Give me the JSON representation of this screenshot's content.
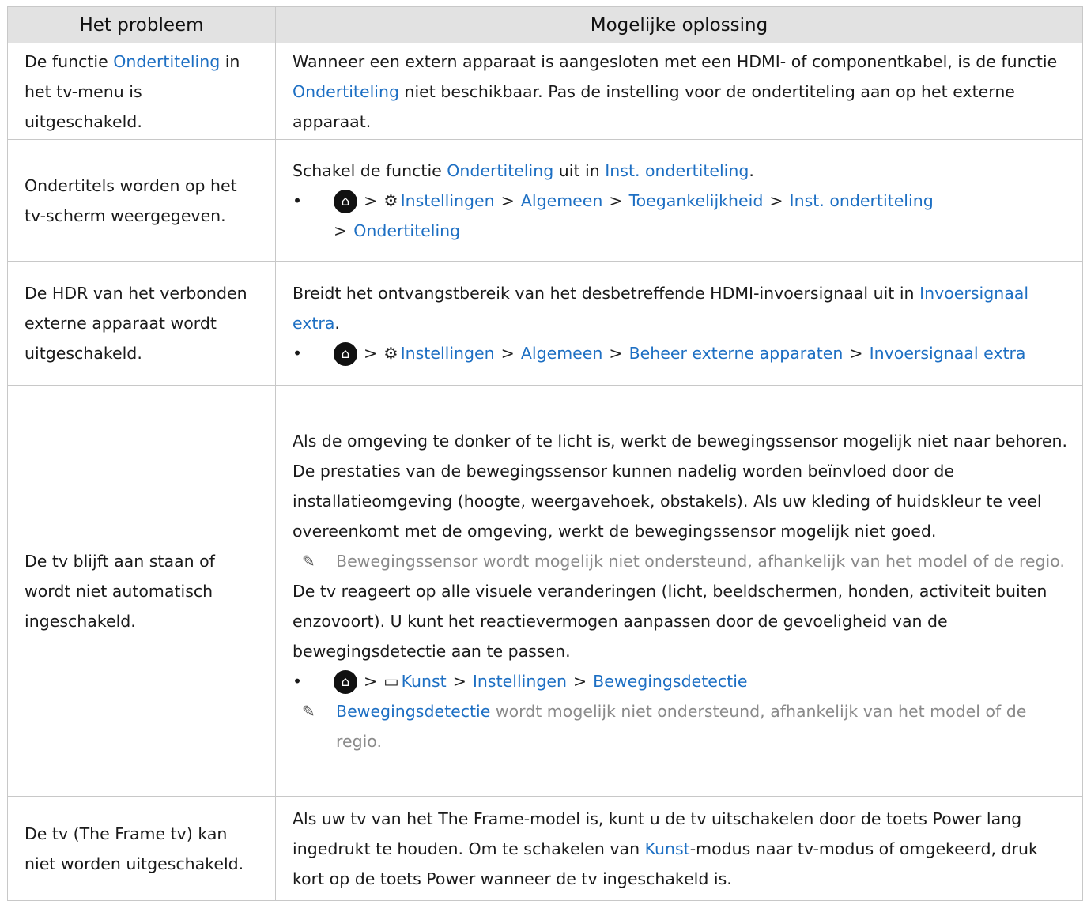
{
  "header": {
    "col1": "Het probleem",
    "col2": "Mogelijke oplossing"
  },
  "icons": {
    "home": "home-icon",
    "chevron": "chevron-right-icon",
    "gear": "gear-icon",
    "art": "art-mode-icon",
    "note": "pencil-note-icon",
    "bullet": "bullet"
  },
  "colors": {
    "link": "#1d6fc3",
    "note_text": "#8a8a8a",
    "header_bg": "#e2e2e2",
    "border": "#c8c8c8"
  },
  "rows": [
    {
      "problem": [
        "De functie ",
        "Ondertiteling",
        " in het tv-menu is uitgeschakeld."
      ],
      "solution": {
        "t1": "Wanneer een extern apparaat is aangesloten met een HDMI- of componentkabel, is de functie ",
        "l1": "Ondertiteling",
        "t2": " niet beschikbaar. Pas de instelling voor de ondertiteling aan op het externe apparaat."
      }
    },
    {
      "problem": "Ondertitels worden op het tv-scherm weergegeven.",
      "solution": {
        "t1": "Schakel de functie ",
        "l1": "Ondertiteling",
        "t2": " uit in ",
        "l2": "Inst. ondertiteling",
        "t3": ".",
        "path": [
          "Instellingen",
          "Algemeen",
          "Toegankelijkheid",
          "Inst. ondertiteling",
          "Ondertiteling"
        ]
      }
    },
    {
      "problem": "De HDR van het verbonden externe apparaat wordt uitgeschakeld.",
      "solution": {
        "t1": "Breidt het ontvangstbereik van het desbetreffende HDMI-invoersignaal uit in ",
        "l1": "Invoersignaal extra",
        "t2": ".",
        "path": [
          "Instellingen",
          "Algemeen",
          "Beheer externe apparaten",
          "Invoersignaal extra"
        ]
      }
    },
    {
      "problem": "De tv blijft aan staan of wordt niet automatisch ingeschakeld.",
      "solution": {
        "p1": "Als de omgeving te donker of te licht is, werkt de bewegingssensor mogelijk niet naar behoren. De prestaties van de bewegingssensor kunnen nadelig worden beïnvloed door de installatieomgeving (hoogte, weergavehoek, obstakels). Als uw kleding of huidskleur te veel overeenkomt met de omgeving, werkt de bewegingssensor mogelijk niet goed.",
        "note1": "Bewegingssensor wordt mogelijk niet ondersteund, afhankelijk van het model of de regio.",
        "p2": "De tv reageert op alle visuele veranderingen (licht, beeldschermen, honden, activiteit buiten enzovoort). U kunt het reactievermogen aanpassen door de gevoeligheid van de bewegingsdetectie aan te passen.",
        "path": [
          "Kunst",
          "Instellingen",
          "Bewegingsdetectie"
        ],
        "note2_link": "Bewegingsdetectie",
        "note2_text": " wordt mogelijk niet ondersteund, afhankelijk van het model of de regio."
      }
    },
    {
      "problem": "De tv (The Frame tv) kan niet worden uitgeschakeld.",
      "solution": {
        "t1": "Als uw tv van het The Frame-model is, kunt u de tv uitschakelen door de toets Power lang ingedrukt te houden. Om te schakelen van ",
        "l1": "Kunst",
        "t2": "-modus naar tv-modus of omgekeerd, druk kort op de toets Power wanneer de tv ingeschakeld is."
      }
    }
  ]
}
